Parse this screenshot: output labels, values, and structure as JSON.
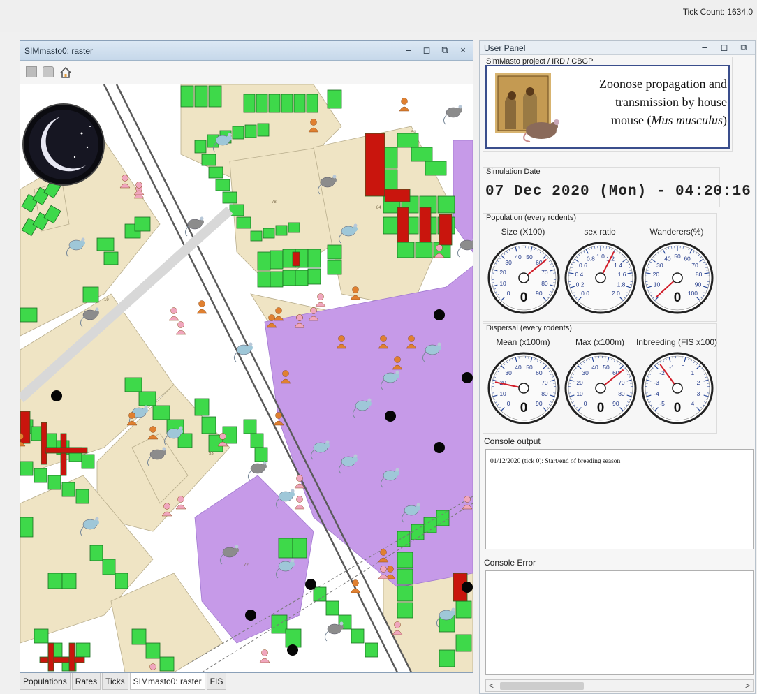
{
  "tick_count": "Tick Count: 1634.0",
  "raster_window": {
    "title": "SIMmasto0: raster",
    "controls": [
      "–",
      "◻",
      "⧉",
      "×"
    ]
  },
  "map": {
    "colors": {
      "building_plot": "#efe4c4",
      "dwelling": "#3ed94a",
      "infested_room": "#c9150d",
      "open_area": "#c69ae8",
      "road_line": "#6a6a6a",
      "rodent_blue": "#9fc7d8",
      "rodent_grey": "#8c8c8c",
      "human_orange": "#e08030",
      "human_pink": "#f0a6bd"
    },
    "plot_labels": [
      "19",
      "78",
      "84",
      "53",
      "72",
      "51"
    ]
  },
  "tabs": [
    {
      "label": "Populations"
    },
    {
      "label": "Rates"
    },
    {
      "label": "Ticks"
    },
    {
      "label": "SIMmasto0: raster"
    },
    {
      "label": "FIS"
    }
  ],
  "user_panel": {
    "title": "User Panel",
    "controls": [
      "–",
      "◻",
      "⧉"
    ],
    "project_label": "SimMasto project / IRD / CBGP",
    "project_text_1": "Zoonose propagation and",
    "project_text_2": "transmission by house",
    "project_text_3a": "mouse (",
    "project_text_3b": "Mus musculus",
    "project_text_3c": ")",
    "sim_date_label": "Simulation Date",
    "sim_date": "07 Dec 2020 (Mon) - 04:20:16",
    "population_label": "Population (every rodents)",
    "population_gauges": [
      {
        "label": "Size (X100)",
        "ticks": [
          "0",
          "10",
          "20",
          "30",
          "40",
          "50",
          "60",
          "70",
          "80",
          "90"
        ],
        "value": 62,
        "min": 0,
        "max": 90,
        "readout": "0"
      },
      {
        "label": "sex ratio",
        "ticks": [
          "0.0",
          "0.2",
          "0.4",
          "0.6",
          "0.8",
          "1.0",
          "1.2",
          "1.4",
          "1.6",
          "1.8",
          "2.0"
        ],
        "value": 1.2,
        "min": 0,
        "max": 2.0,
        "readout": ""
      },
      {
        "label": "Wanderers(%)",
        "ticks": [
          "0",
          "10",
          "20",
          "30",
          "40",
          "50",
          "60",
          "70",
          "80",
          "90",
          "100"
        ],
        "value": 1,
        "min": 0,
        "max": 100,
        "readout": "0"
      }
    ],
    "dispersal_label": "Dispersal (every rodents)",
    "dispersal_gauges": [
      {
        "label": "Mean  (x100m)",
        "ticks": [
          "0",
          "10",
          "20",
          "30",
          "40",
          "50",
          "60",
          "70",
          "80",
          "90"
        ],
        "value": 19,
        "min": 0,
        "max": 90,
        "readout": "0"
      },
      {
        "label": "Max (x100m)",
        "ticks": [
          "0",
          "10",
          "20",
          "30",
          "40",
          "50",
          "60",
          "70",
          "80",
          "90"
        ],
        "value": 62,
        "min": 0,
        "max": 90,
        "readout": "0"
      },
      {
        "label": "Inbreeding (FIS x100)",
        "ticks": [
          "-5",
          "-4",
          "-3",
          "-2",
          "-1",
          "0",
          "1",
          "2",
          "3",
          "4"
        ],
        "value": -1.7,
        "min": -5,
        "max": 4,
        "readout": "0"
      }
    ],
    "console_output_label": "Console output",
    "console_output_text": "01/12/2020 (tick 0): Start/end of breeding season",
    "console_error_label": "Console Error",
    "scroll_left": "<",
    "scroll_right": ">"
  }
}
